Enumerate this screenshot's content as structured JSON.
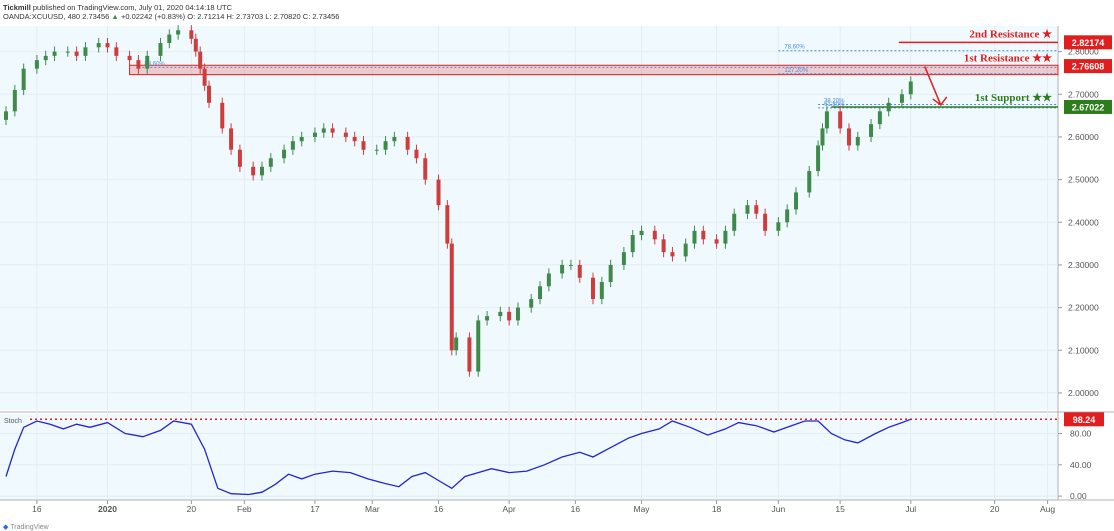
{
  "header": {
    "author": "Tickmill",
    "published_text": "published on TradingView.com, July 01, 2020 04:14:18 UTC",
    "symbol": "OANDA:XCUUSD, 480",
    "last": "2.73456",
    "change": "+0.02242 (+0.83%)",
    "ohlc": "O: 2.71214  H: 2.73703  L: 2.70820  C: 2.73456"
  },
  "footer": {
    "logo_text": "TradingView"
  },
  "colors": {
    "background": "#f0fafe",
    "up": "#3f8a4b",
    "down": "#cf3c3c",
    "resistance": "#e01e1e",
    "support": "#2e7d1c",
    "stoch": "#2323d8",
    "fib": "#4a90d9"
  },
  "chart_data": [
    {
      "type": "candlestick",
      "ylim": [
        1.96,
        2.86
      ],
      "y_ticks": [
        "2.80000",
        "2.70000",
        "2.60000",
        "2.50000",
        "2.40000",
        "2.30000",
        "2.20000",
        "2.10000",
        "2.00000"
      ],
      "y_tick_values": [
        2.8,
        2.7,
        2.6,
        2.5,
        2.4,
        2.3,
        2.2,
        2.1,
        2.0
      ],
      "x_ticks": [
        "16",
        "2020",
        "20",
        "Feb",
        "17",
        "Mar",
        "16",
        "Apr",
        "16",
        "May",
        "18",
        "Jun",
        "15",
        "Jul",
        "20",
        "Aug"
      ],
      "x_tick_dates": [
        "2019-12-16",
        "2020-01-01",
        "2020-01-20",
        "2020-02-01",
        "2020-02-17",
        "2020-03-01",
        "2020-03-16",
        "2020-04-01",
        "2020-04-16",
        "2020-05-01",
        "2020-05-18",
        "2020-06-01",
        "2020-06-15",
        "2020-07-01",
        "2020-07-20",
        "2020-08-01"
      ],
      "x_range": [
        "2019-12-09",
        "2020-08-02"
      ],
      "series": [
        {
          "values": [
            [
              "2019-12-09",
              2.66
            ],
            [
              "2019-12-11",
              2.71
            ],
            [
              "2019-12-13",
              2.76
            ],
            [
              "2019-12-16",
              2.78
            ],
            [
              "2019-12-18",
              2.79
            ],
            [
              "2019-12-20",
              2.8
            ],
            [
              "2019-12-23",
              2.8
            ],
            [
              "2019-12-25",
              2.79
            ],
            [
              "2019-12-27",
              2.81
            ],
            [
              "2019-12-30",
              2.82
            ],
            [
              "2020-01-01",
              2.81
            ],
            [
              "2020-01-03",
              2.79
            ],
            [
              "2020-01-06",
              2.78
            ],
            [
              "2020-01-08",
              2.76
            ],
            [
              "2020-01-10",
              2.79
            ],
            [
              "2020-01-13",
              2.82
            ],
            [
              "2020-01-15",
              2.84
            ],
            [
              "2020-01-17",
              2.85
            ],
            [
              "2020-01-20",
              2.83
            ],
            [
              "2020-01-21",
              2.8
            ],
            [
              "2020-01-22",
              2.76
            ],
            [
              "2020-01-23",
              2.72
            ],
            [
              "2020-01-24",
              2.68
            ],
            [
              "2020-01-27",
              2.62
            ],
            [
              "2020-01-29",
              2.57
            ],
            [
              "2020-01-31",
              2.53
            ],
            [
              "2020-02-03",
              2.51
            ],
            [
              "2020-02-05",
              2.53
            ],
            [
              "2020-02-07",
              2.55
            ],
            [
              "2020-02-10",
              2.57
            ],
            [
              "2020-02-12",
              2.59
            ],
            [
              "2020-02-14",
              2.6
            ],
            [
              "2020-02-17",
              2.61
            ],
            [
              "2020-02-19",
              2.62
            ],
            [
              "2020-02-21",
              2.61
            ],
            [
              "2020-02-24",
              2.6
            ],
            [
              "2020-02-26",
              2.59
            ],
            [
              "2020-02-28",
              2.57
            ],
            [
              "2020-03-02",
              2.57
            ],
            [
              "2020-03-04",
              2.59
            ],
            [
              "2020-03-06",
              2.6
            ],
            [
              "2020-03-09",
              2.57
            ],
            [
              "2020-03-11",
              2.55
            ],
            [
              "2020-03-13",
              2.5
            ],
            [
              "2020-03-16",
              2.44
            ],
            [
              "2020-03-18",
              2.35
            ],
            [
              "2020-03-19",
              2.1
            ],
            [
              "2020-03-20",
              2.13
            ],
            [
              "2020-03-23",
              2.05
            ],
            [
              "2020-03-25",
              2.17
            ],
            [
              "2020-03-27",
              2.18
            ],
            [
              "2020-03-30",
              2.19
            ],
            [
              "2020-04-01",
              2.17
            ],
            [
              "2020-04-03",
              2.2
            ],
            [
              "2020-04-06",
              2.22
            ],
            [
              "2020-04-08",
              2.25
            ],
            [
              "2020-04-10",
              2.28
            ],
            [
              "2020-04-13",
              2.3
            ],
            [
              "2020-04-15",
              2.3
            ],
            [
              "2020-04-17",
              2.27
            ],
            [
              "2020-04-20",
              2.22
            ],
            [
              "2020-04-22",
              2.26
            ],
            [
              "2020-04-24",
              2.3
            ],
            [
              "2020-04-27",
              2.33
            ],
            [
              "2020-04-29",
              2.37
            ],
            [
              "2020-05-01",
              2.38
            ],
            [
              "2020-05-04",
              2.36
            ],
            [
              "2020-05-06",
              2.33
            ],
            [
              "2020-05-08",
              2.32
            ],
            [
              "2020-05-11",
              2.35
            ],
            [
              "2020-05-13",
              2.38
            ],
            [
              "2020-05-15",
              2.36
            ],
            [
              "2020-05-18",
              2.35
            ],
            [
              "2020-05-20",
              2.38
            ],
            [
              "2020-05-22",
              2.42
            ],
            [
              "2020-05-25",
              2.44
            ],
            [
              "2020-05-27",
              2.42
            ],
            [
              "2020-05-29",
              2.38
            ],
            [
              "2020-06-01",
              2.4
            ],
            [
              "2020-06-03",
              2.43
            ],
            [
              "2020-06-05",
              2.47
            ],
            [
              "2020-06-08",
              2.52
            ],
            [
              "2020-06-10",
              2.58
            ],
            [
              "2020-06-11",
              2.62
            ],
            [
              "2020-06-12",
              2.66
            ],
            [
              "2020-06-15",
              2.62
            ],
            [
              "2020-06-17",
              2.58
            ],
            [
              "2020-06-19",
              2.6
            ],
            [
              "2020-06-22",
              2.63
            ],
            [
              "2020-06-24",
              2.66
            ],
            [
              "2020-06-26",
              2.68
            ],
            [
              "2020-06-29",
              2.7
            ],
            [
              "2020-07-01",
              2.73
            ]
          ]
        }
      ],
      "annotations": {
        "resistance_2": {
          "label": "2nd Resistance ★",
          "value": 2.82174,
          "price_label": "2.82174"
        },
        "resistance_1": {
          "label": "1st Resistance ★★",
          "value": 2.76608,
          "price_label": "2.76608",
          "zone": [
            2.746,
            2.768
          ]
        },
        "support_1": {
          "label": "1st Support ★★",
          "value": 2.67022,
          "price_label": "2.67022"
        },
        "fib_786": {
          "label": "78.60%",
          "value": 2.802
        },
        "fib_886": {
          "label": "88.60%",
          "value": 2.763
        },
        "fib_1272": {
          "label": "127.20%",
          "value": 2.748
        },
        "fib_382": {
          "label": "38.20%",
          "value": 2.676
        },
        "fib_618": {
          "label": "61.80%",
          "value": 2.668
        }
      }
    },
    {
      "type": "line",
      "title": "Stoch",
      "ylim": [
        -5,
        105
      ],
      "y_ticks": [
        "80.00",
        "40.00",
        "0.00"
      ],
      "y_tick_values": [
        80,
        40,
        0
      ],
      "current_label": "98.24",
      "current_value": 98.24,
      "series": [
        {
          "values": [
            [
              "2019-12-09",
              25
            ],
            [
              "2019-12-11",
              60
            ],
            [
              "2019-12-13",
              88
            ],
            [
              "2019-12-16",
              96
            ],
            [
              "2019-12-19",
              92
            ],
            [
              "2019-12-22",
              86
            ],
            [
              "2019-12-25",
              92
            ],
            [
              "2019-12-28",
              88
            ],
            [
              "2020-01-01",
              94
            ],
            [
              "2020-01-05",
              80
            ],
            [
              "2020-01-09",
              76
            ],
            [
              "2020-01-13",
              84
            ],
            [
              "2020-01-16",
              96
            ],
            [
              "2020-01-20",
              92
            ],
            [
              "2020-01-23",
              60
            ],
            [
              "2020-01-26",
              10
            ],
            [
              "2020-01-29",
              3
            ],
            [
              "2020-02-02",
              2
            ],
            [
              "2020-02-05",
              5
            ],
            [
              "2020-02-08",
              15
            ],
            [
              "2020-02-11",
              28
            ],
            [
              "2020-02-14",
              22
            ],
            [
              "2020-02-17",
              28
            ],
            [
              "2020-02-21",
              32
            ],
            [
              "2020-02-25",
              30
            ],
            [
              "2020-02-29",
              22
            ],
            [
              "2020-03-04",
              16
            ],
            [
              "2020-03-07",
              12
            ],
            [
              "2020-03-10",
              25
            ],
            [
              "2020-03-13",
              30
            ],
            [
              "2020-03-16",
              20
            ],
            [
              "2020-03-19",
              10
            ],
            [
              "2020-03-22",
              25
            ],
            [
              "2020-03-25",
              30
            ],
            [
              "2020-03-28",
              35
            ],
            [
              "2020-04-01",
              30
            ],
            [
              "2020-04-05",
              32
            ],
            [
              "2020-04-09",
              40
            ],
            [
              "2020-04-13",
              50
            ],
            [
              "2020-04-17",
              56
            ],
            [
              "2020-04-20",
              50
            ],
            [
              "2020-04-24",
              62
            ],
            [
              "2020-04-28",
              74
            ],
            [
              "2020-05-01",
              80
            ],
            [
              "2020-05-05",
              86
            ],
            [
              "2020-05-08",
              96
            ],
            [
              "2020-05-12",
              88
            ],
            [
              "2020-05-16",
              78
            ],
            [
              "2020-05-20",
              86
            ],
            [
              "2020-05-23",
              94
            ],
            [
              "2020-05-27",
              90
            ],
            [
              "2020-05-31",
              82
            ],
            [
              "2020-06-03",
              88
            ],
            [
              "2020-06-07",
              96
            ],
            [
              "2020-06-10",
              96
            ],
            [
              "2020-06-13",
              80
            ],
            [
              "2020-06-16",
              72
            ],
            [
              "2020-06-19",
              68
            ],
            [
              "2020-06-23",
              80
            ],
            [
              "2020-06-26",
              88
            ],
            [
              "2020-06-29",
              94
            ],
            [
              "2020-07-01",
              98.24
            ]
          ]
        }
      ]
    }
  ]
}
